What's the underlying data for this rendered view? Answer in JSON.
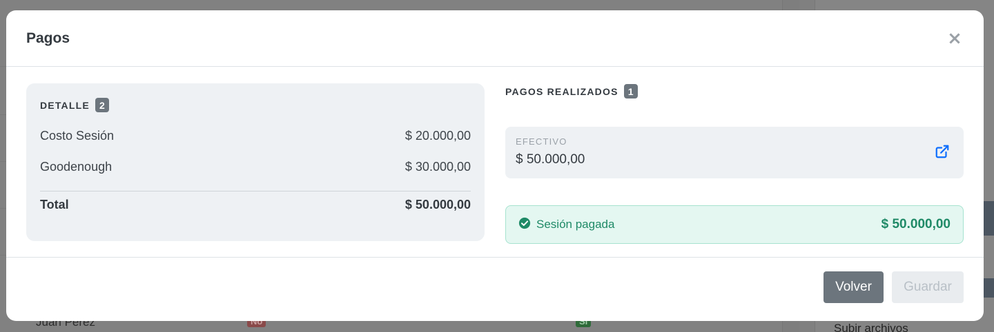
{
  "background": {
    "row_name": "Juan Pérez",
    "badge_no": "No",
    "badge_si": "Sí",
    "side_link": "Subir archivos"
  },
  "modal": {
    "title": "Pagos",
    "close_symbol": "×"
  },
  "detail": {
    "label": "DETALLE",
    "count": "2",
    "items": [
      {
        "label": "Costo Sesión",
        "amount": "$ 20.000,00"
      },
      {
        "label": "Goodenough",
        "amount": "$ 30.000,00"
      }
    ],
    "total_label": "Total",
    "total_amount": "$ 50.000,00"
  },
  "payments": {
    "label": "PAGOS REALIZADOS",
    "count": "1",
    "items": [
      {
        "method": "EFECTIVO",
        "amount": "$ 50.000,00",
        "edit_icon": "external-link-icon"
      }
    ],
    "status": {
      "icon": "check-circle-icon",
      "text": "Sesión pagada",
      "amount": "$ 50.000,00"
    }
  },
  "footer": {
    "back_label": "Volver",
    "save_label": "Guardar"
  },
  "colors": {
    "success": "#1f8a67",
    "success_bg": "#e4f7f1",
    "link": "#0d6efd",
    "secondary": "#6c757d"
  }
}
